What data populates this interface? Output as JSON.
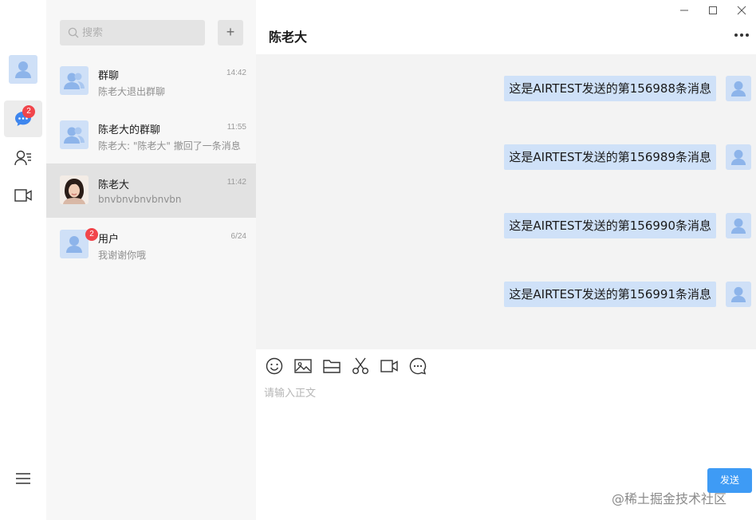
{
  "rail": {
    "chat_badge": "2"
  },
  "search": {
    "placeholder": "搜索"
  },
  "add_label": "+",
  "conversations": [
    {
      "name": "群聊",
      "preview": "陈老大退出群聊",
      "time": "14:42"
    },
    {
      "name": "陈老大的群聊",
      "preview": "陈老大: \"陈老大\" 撤回了一条消息",
      "time": "11:55"
    },
    {
      "name": "陈老大",
      "preview": "bnvbnvbnvbnvbn",
      "time": "11:42"
    },
    {
      "name": "用户",
      "preview": "我谢谢你哦",
      "time": "6/24",
      "badge": "2"
    }
  ],
  "chat": {
    "title": "陈老大",
    "messages": [
      "这是AIRTEST发送的第156988条消息",
      "这是AIRTEST发送的第156989条消息",
      "这是AIRTEST发送的第156990条消息",
      "这是AIRTEST发送的第156991条消息"
    ],
    "input_placeholder": "请输入正文",
    "send_label": "发送"
  },
  "watermark": "@稀土掘金技术社区",
  "colors": {
    "accent": "#3e9bf5",
    "bubble": "#cfe1f8",
    "badge": "#f1454b",
    "avatar_bg": "#cfe0f7",
    "avatar_icon": "#8db4ea"
  }
}
